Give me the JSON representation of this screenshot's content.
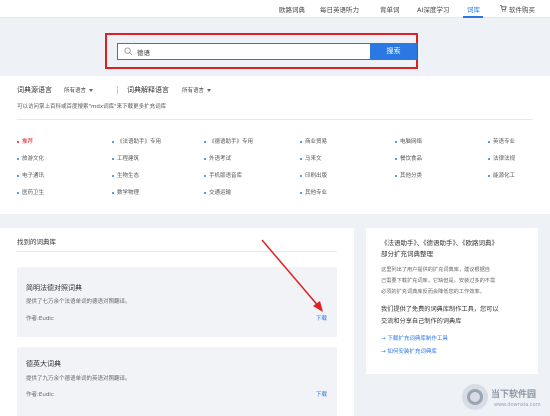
{
  "nav": {
    "items": [
      {
        "label": "欧路词典",
        "active": false
      },
      {
        "label": "每日英语听力",
        "active": false
      },
      {
        "label": "背单词",
        "active": false
      },
      {
        "label": "AI深度学习",
        "active": false
      },
      {
        "label": "词库",
        "active": true
      }
    ],
    "cart_label": "软件购买",
    "accent": "#2b78e4"
  },
  "search": {
    "value": "德语",
    "button_label": "搜索",
    "highlight_color": "#e02020"
  },
  "filters": {
    "source_lang_label": "词典源语言",
    "source_lang_value": "所有语言",
    "target_lang_label": "词典解释语言",
    "target_lang_value": "所有语言",
    "hint": "可以访问掌上百科或百度搜索\"mdx词库\"来下载更多扩充词库",
    "categories": [
      [
        "推荐",
        "《法语助手》专用",
        "《德语助手》专用",
        "商业贸易",
        "电脑网络",
        "英语专业"
      ],
      [
        "旅游文化",
        "工程建筑",
        "外语考试",
        "马来文",
        "餐饮食品",
        "法律法规"
      ],
      [
        "电子通讯",
        "生物生态",
        "手机版语音库",
        "印刷出版",
        "其他分类",
        "能源化工"
      ],
      [
        "医药卫生",
        "数学物理",
        "交通运输",
        "其他专业"
      ]
    ]
  },
  "results": {
    "title": "找到的词典库",
    "items": [
      {
        "name": "简明法德对照词典",
        "desc": "提供了七万余个法语单词的德语对照翻译。",
        "author": "作者:Eudic",
        "download": "下载"
      },
      {
        "name": "德英大词典",
        "desc": "提供了九万余个德语单词的英语对照翻译。",
        "author": "作者:Eudic",
        "download": "下载"
      }
    ]
  },
  "sidebar": {
    "title_line1": "《法语助手》、《德语助手》、《欧路词典》",
    "title_line2": "部分扩充词典整理",
    "body_lines": [
      "这里列出了用户提供的扩充词典库，建议根据自",
      "己需要下载扩充词库，它缺但是，安装过多的不需",
      "必须的扩充词典库反而会降低您的工作效率。"
    ],
    "promo_line1": "我们提供了免费的词典库制作工具，您可以",
    "promo_line2": "交流和分享自己制作的词典库",
    "links": [
      "→ 下载扩充词典库制作工具",
      "→ 如何安装扩充词典库"
    ]
  },
  "watermark": {
    "text": "当下软件园",
    "url": "www.downxia.com"
  }
}
